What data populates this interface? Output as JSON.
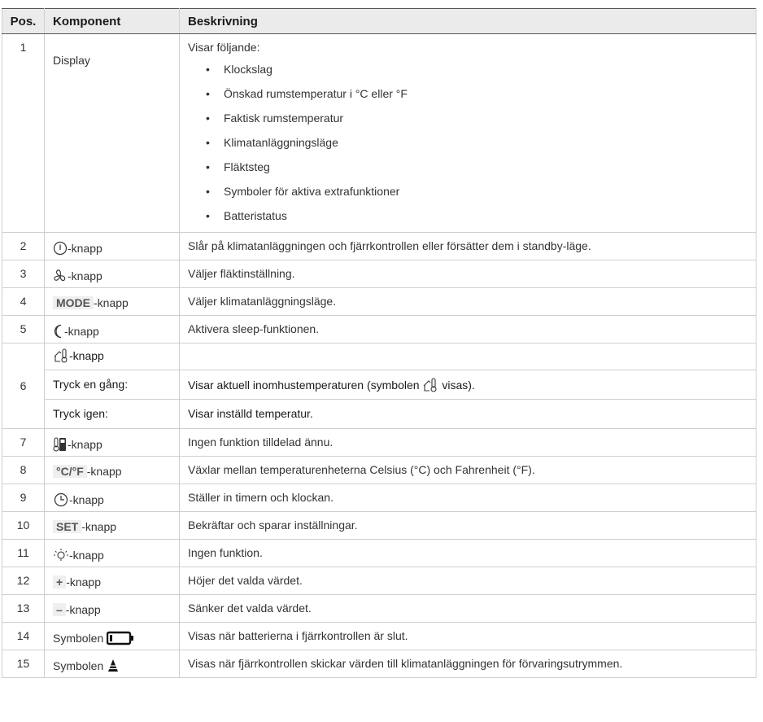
{
  "headers": {
    "pos": "Pos.",
    "comp": "Komponent",
    "desc": "Beskrivning"
  },
  "rows": [
    {
      "pos": "1",
      "comp": "Display",
      "desc": "Visar följande:",
      "bullets": [
        "Klockslag",
        "Önskad rumstemperatur i °C eller °F",
        "Faktisk rumstemperatur",
        "Klimatanläggningsläge",
        "Fläktsteg",
        "Symboler för aktiva extrafunktioner",
        "Batteristatus"
      ]
    },
    {
      "pos": "2",
      "comp": "-knapp",
      "icon": "power-icon",
      "desc": "Slår på klimatanläggningen och fjärrkontrollen eller försätter dem i standby-läge."
    },
    {
      "pos": "3",
      "comp": "-knapp",
      "icon": "fan-icon",
      "desc": "Väljer fläktinställning."
    },
    {
      "pos": "4",
      "comp": "-knapp",
      "tag": "MODE",
      "desc": "Väljer klimatanläggningsläge."
    },
    {
      "pos": "5",
      "comp": "-knapp",
      "icon": "moon-icon",
      "desc": "Aktivera sleep-funktionen."
    },
    {
      "pos": "6",
      "comp": "-knapp",
      "icon": "indoor-temp-icon",
      "sub": [
        {
          "comp": "Tryck en gång:",
          "desc_a": "Visar aktuell inomhustemperaturen (symbolen ",
          "desc_b": " visas)."
        },
        {
          "comp": "Tryck igen:",
          "desc": "Visar inställd temperatur."
        }
      ]
    },
    {
      "pos": "7",
      "comp": "-knapp",
      "icon": "thermometer-remote-icon",
      "desc": "Ingen funktion tilldelad ännu."
    },
    {
      "pos": "8",
      "comp": "-knapp",
      "tag": "°C/°F",
      "desc": "Växlar mellan temperaturenheterna Celsius (°C) och Fahrenheit (°F)."
    },
    {
      "pos": "9",
      "comp": "-knapp",
      "icon": "clock-icon",
      "desc": "Ställer in timern och klockan."
    },
    {
      "pos": "10",
      "comp": "-knapp",
      "tag": "SET",
      "desc": "Bekräftar och sparar inställningar."
    },
    {
      "pos": "11",
      "comp": "-knapp",
      "icon": "light-bulb-icon",
      "desc": "Ingen funktion."
    },
    {
      "pos": "12",
      "comp": "-knapp",
      "tag": "+",
      "desc": "Höjer det valda värdet."
    },
    {
      "pos": "13",
      "comp": "-knapp",
      "tag": "–",
      "desc": "Sänker det valda värdet."
    },
    {
      "pos": "14",
      "comp": "Symbolen ",
      "icon": "battery-empty-icon",
      "desc": "Visas när batterierna i fjärrkontrollen är slut."
    },
    {
      "pos": "15",
      "comp": "Symbolen ",
      "icon": "storage-cone-icon",
      "desc": "Visas när fjärrkontrollen skickar värden till klimatanläggningen för förvaringsutrymmen."
    }
  ]
}
